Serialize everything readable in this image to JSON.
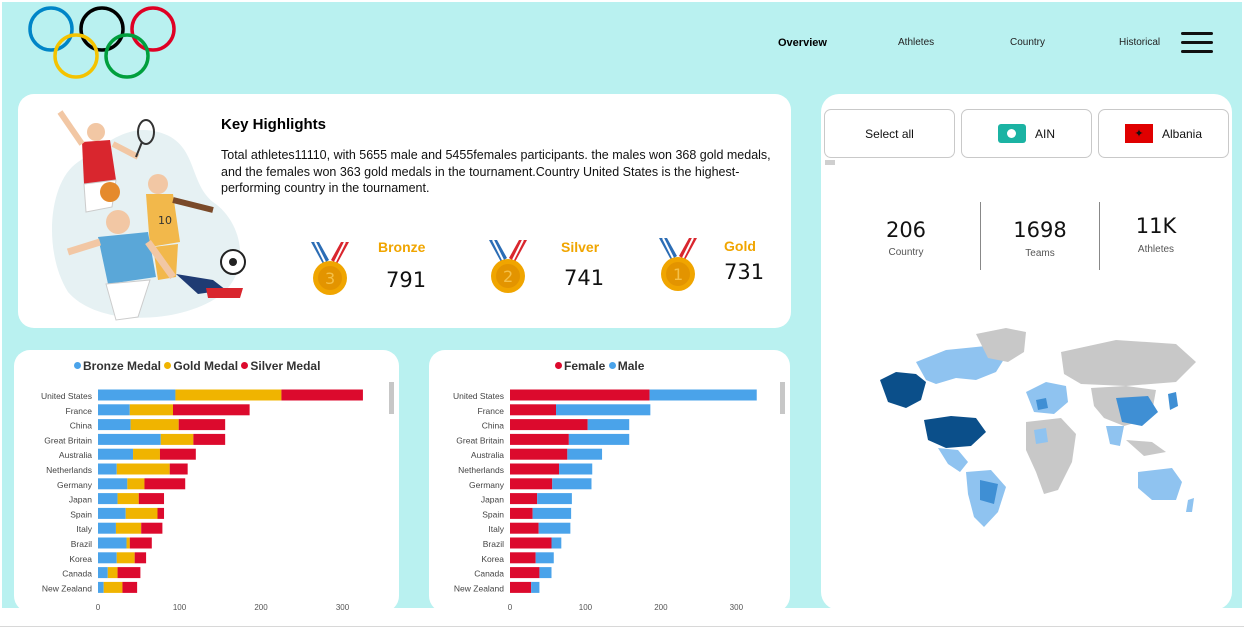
{
  "nav": {
    "items": [
      "Overview",
      "Athletes",
      "Country",
      "Historical"
    ],
    "active": "Overview",
    "ring_colors": [
      "#0085c7",
      "#000000",
      "#df0024",
      "#f4c300",
      "#009f3d"
    ]
  },
  "highlights": {
    "title": "Key Highlights",
    "text": "Total athletes11110, with 5655 male and 5455females participants. the males won 368 gold medals, and the females won 363 gold medals in the tournament.Country United States is the highest-performing country in the tournament.",
    "illustration_icon": "athletes-illustration",
    "medals": [
      {
        "label": "Bronze",
        "value": "791",
        "rank": "3"
      },
      {
        "label": "Silver",
        "value": "741",
        "rank": "2"
      },
      {
        "label": "Gold",
        "value": "731",
        "rank": "1"
      }
    ]
  },
  "slicers": [
    {
      "label": "Select all"
    },
    {
      "label": "AIN",
      "icon": "ain-flag-icon"
    },
    {
      "label": "Albania",
      "icon": "albania-flag-icon"
    }
  ],
  "kpis": [
    {
      "value": "206",
      "label": "Country"
    },
    {
      "value": "1698",
      "label": "Teams"
    },
    {
      "value": "11K",
      "label": "Athletes"
    }
  ],
  "map": {
    "icon": "world-map",
    "colors": {
      "high": "#0b4f8a",
      "mid": "#3f8fd4",
      "low": "#8fc3f0",
      "none": "#c8c8c8"
    }
  },
  "colors": {
    "bronze_series": "#4aa3ea",
    "gold_series": "#f0b400",
    "silver_series": "#dc0a2d",
    "female": "#dc0a2d",
    "male": "#4aa3ea",
    "medal_text": "#f0a500",
    "background": "#b9f1f0"
  },
  "chart_data": [
    {
      "type": "bar",
      "orientation": "horizontal",
      "stacked": true,
      "categories": [
        "United States",
        "France",
        "China",
        "Great Britain",
        "Australia",
        "Netherlands",
        "Germany",
        "Japan",
        "Spain",
        "Italy",
        "Brazil",
        "Korea",
        "Canada",
        "New Zealand"
      ],
      "series": [
        {
          "name": "Bronze Medal",
          "values": [
            95,
            39,
            40,
            77,
            43,
            23,
            36,
            24,
            34,
            22,
            35,
            23,
            12,
            7
          ]
        },
        {
          "name": "Gold Medal",
          "values": [
            130,
            53,
            59,
            40,
            33,
            65,
            21,
            26,
            39,
            31,
            4,
            22,
            12,
            23
          ]
        },
        {
          "name": "Silver Medal",
          "values": [
            100,
            94,
            57,
            39,
            44,
            22,
            50,
            31,
            8,
            26,
            27,
            14,
            28,
            18
          ]
        }
      ],
      "xlim": [
        0,
        330
      ],
      "xticks": [
        0,
        100,
        200,
        300
      ],
      "legend": "top"
    },
    {
      "type": "bar",
      "orientation": "horizontal",
      "stacked": true,
      "categories": [
        "United States",
        "France",
        "China",
        "Great Britain",
        "Australia",
        "Netherlands",
        "Germany",
        "Japan",
        "Spain",
        "Italy",
        "Brazil",
        "Korea",
        "Canada",
        "New Zealand"
      ],
      "series": [
        {
          "name": "Female",
          "values": [
            185,
            61,
            103,
            78,
            76,
            65,
            56,
            36,
            30,
            38,
            55,
            34,
            39,
            28
          ]
        },
        {
          "name": "Male",
          "values": [
            142,
            125,
            55,
            80,
            46,
            44,
            52,
            46,
            51,
            42,
            13,
            24,
            16,
            11
          ]
        }
      ],
      "xlim": [
        0,
        330
      ],
      "xticks": [
        0,
        100,
        200,
        300
      ],
      "legend": "top"
    }
  ]
}
